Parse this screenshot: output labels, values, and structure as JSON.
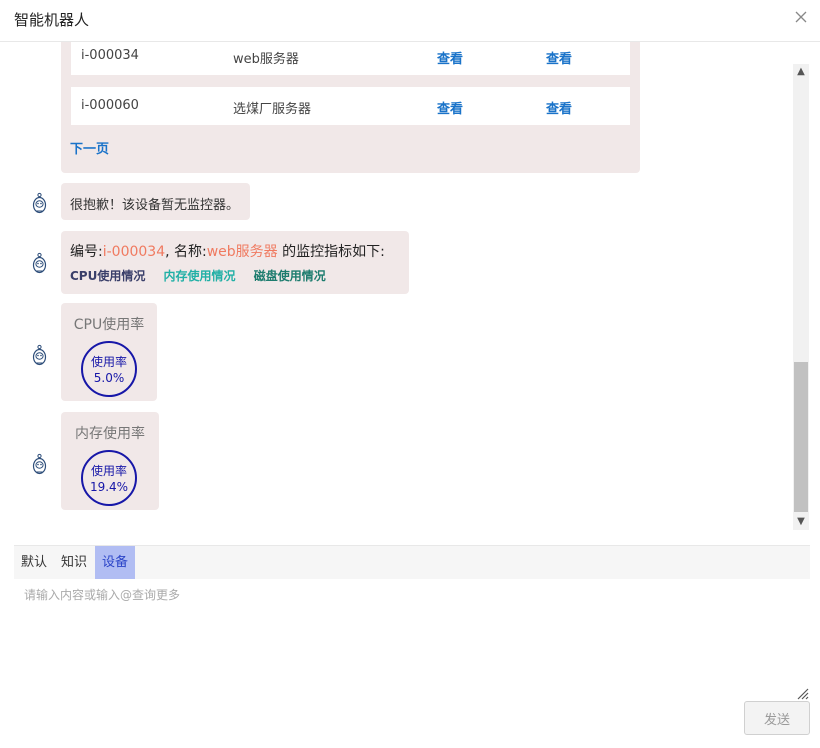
{
  "window": {
    "title": "智能机器人",
    "close_icon": "close-icon"
  },
  "device_table": {
    "rows": [
      {
        "id": "i-000034",
        "name": "web服务器",
        "action1": "查看",
        "action2": "查看"
      },
      {
        "id": "i-000060",
        "name": "选煤厂服务器",
        "action1": "查看",
        "action2": "查看"
      }
    ],
    "next_page": "下一页"
  },
  "messages": {
    "sorry": "很抱歉！该设备暂无监控器。",
    "metrics": {
      "prefix_id": "编号:",
      "device_id": "i-000034",
      "prefix_name": ", 名称:",
      "device_name": "web服务器",
      "suffix": " 的监控指标如下:",
      "links": [
        "CPU使用情况",
        "内存使用情况",
        "磁盘使用情况"
      ]
    },
    "cpu_gauge": {
      "title": "CPU使用率",
      "label": "使用率",
      "value": "5.0%"
    },
    "mem_gauge": {
      "title": "内存使用率",
      "label": "使用率",
      "value": "19.4%"
    }
  },
  "tabs": [
    "默认",
    "知识",
    "设备"
  ],
  "active_tab": "设备",
  "input": {
    "placeholder": "请输入内容或输入@查询更多"
  },
  "send_label": "发送",
  "colors": {
    "bubble": "#f1e8e8",
    "link": "#1a73c9",
    "highlight": "#f07a60",
    "gauge": "#1717a8",
    "active_tab": "#b1bdf3"
  }
}
